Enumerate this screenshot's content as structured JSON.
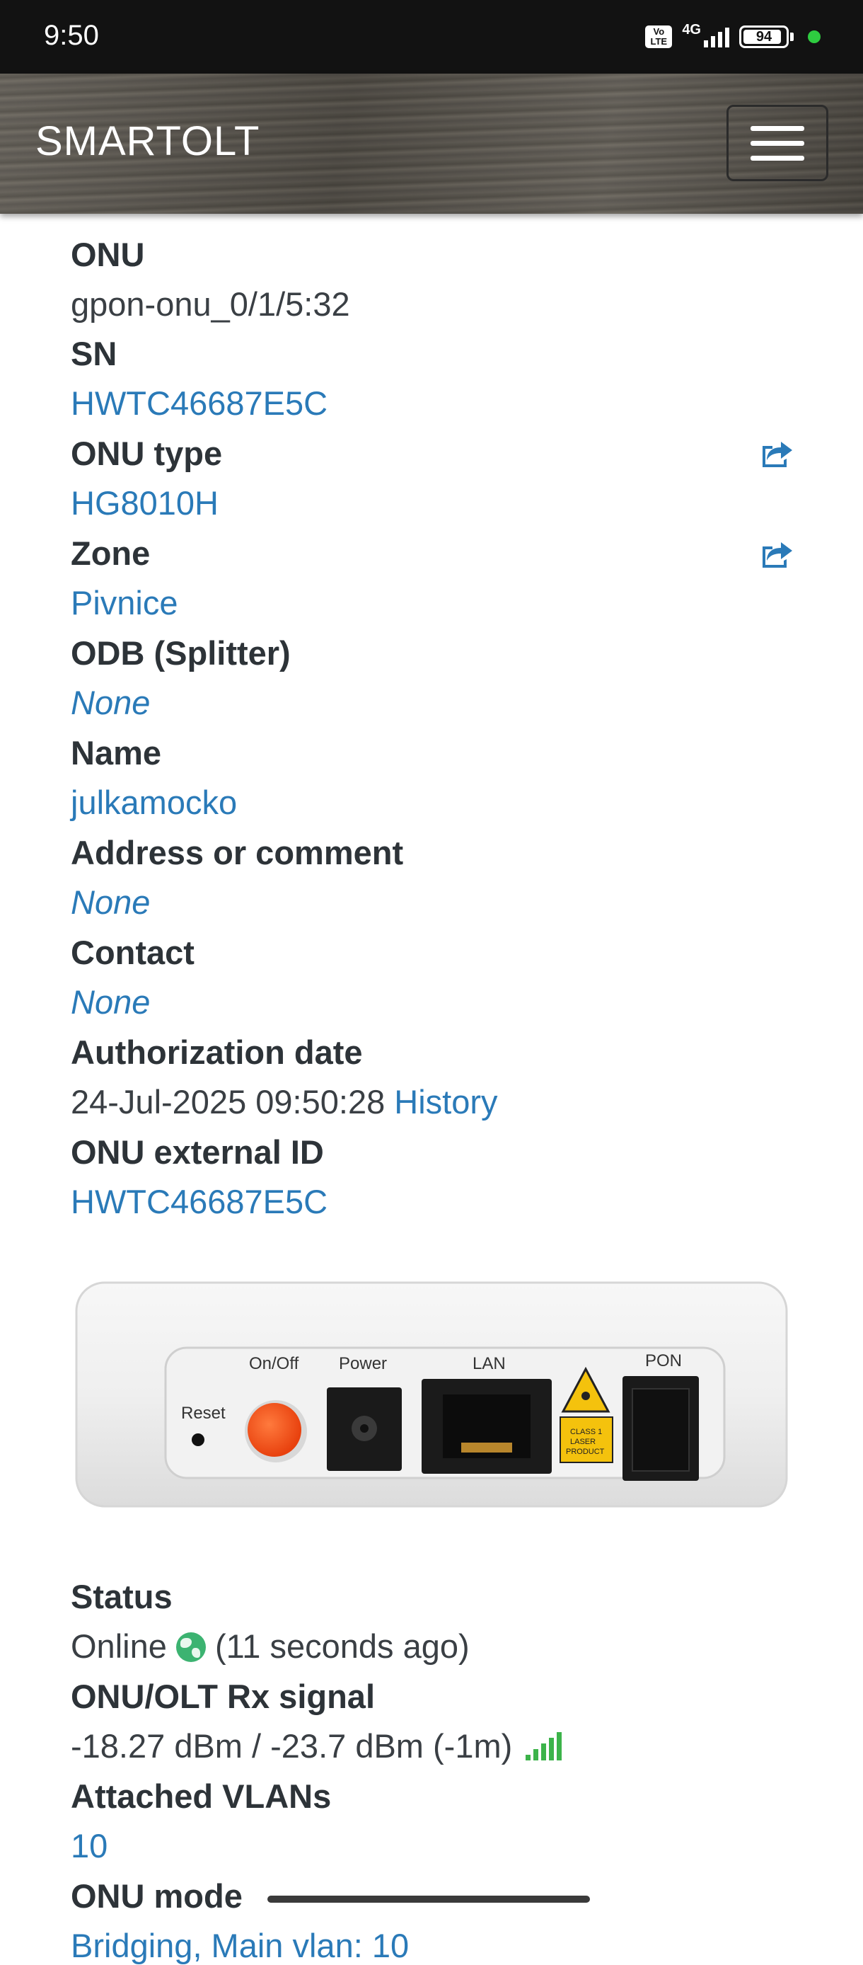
{
  "status_bar": {
    "time": "9:50",
    "volte_label": "Vo LTE",
    "network": "4G",
    "battery": "94"
  },
  "navbar": {
    "brand": "SMARTOLT"
  },
  "fields": {
    "onu": {
      "label": "ONU",
      "value": "gpon-onu_0/1/5:32"
    },
    "sn": {
      "label": "SN",
      "value": "HWTC46687E5C"
    },
    "onu_type": {
      "label": "ONU type",
      "value": "HG8010H"
    },
    "zone": {
      "label": "Zone",
      "value": "Pivnice"
    },
    "odb": {
      "label": "ODB (Splitter)",
      "value": "None"
    },
    "name": {
      "label": "Name",
      "value": "julkamocko"
    },
    "address": {
      "label": "Address or comment",
      "value": "None"
    },
    "contact": {
      "label": "Contact",
      "value": "None"
    },
    "authorization": {
      "label": "Authorization date",
      "value": "24-Jul-2025 09:50:28",
      "link": "History"
    },
    "external_id": {
      "label": "ONU external ID",
      "value": "HWTC46687E5C"
    },
    "status": {
      "label": "Status",
      "value": "Online",
      "ago": "(11 seconds ago)"
    },
    "signal": {
      "label": "ONU/OLT Rx signal",
      "value": "-18.27 dBm / -23.7 dBm (-1m)"
    },
    "vlans": {
      "label": "Attached VLANs",
      "value": "10"
    },
    "onu_mode": {
      "label": "ONU mode",
      "value": "Bridging, Main vlan: 10"
    }
  },
  "device_image": {
    "labels": {
      "onoff": "On/Off",
      "power": "Power",
      "lan": "LAN",
      "pon": "PON",
      "reset": "Reset",
      "laser": "CLASS 1 LASER PRODUCT"
    }
  },
  "colors": {
    "link": "#2a7ab8",
    "online": "#3cb371",
    "signal": "#3cb34a"
  },
  "icons": {
    "edit": "share-square-icon",
    "online": "globe-icon",
    "signal": "signal-bars-icon",
    "menu": "hamburger-icon"
  }
}
